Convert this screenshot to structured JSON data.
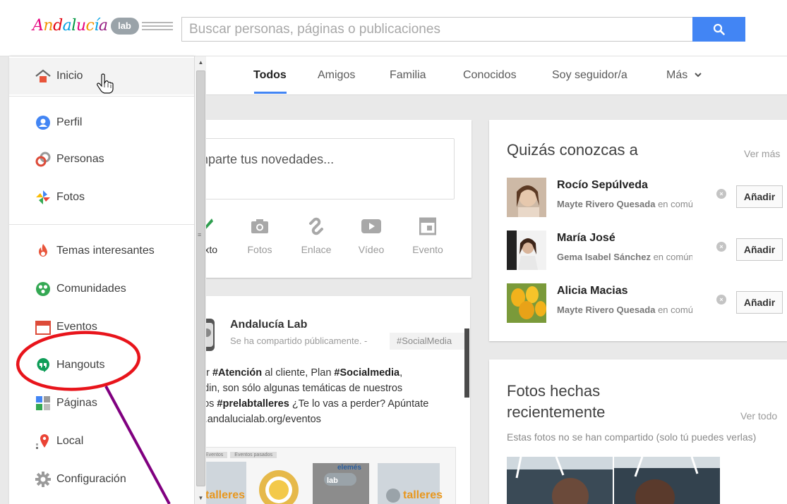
{
  "brand": {
    "logo_text": "Andalucía",
    "logo_badge": "lab"
  },
  "search": {
    "placeholder": "Buscar personas, páginas o publicaciones",
    "icon": "search-icon"
  },
  "sidebar": {
    "items": [
      {
        "key": "inicio",
        "label": "Inicio",
        "icon": "home-icon"
      },
      {
        "key": "perfil",
        "label": "Perfil",
        "icon": "profile-icon"
      },
      {
        "key": "personas",
        "label": "Personas",
        "icon": "people-icon"
      },
      {
        "key": "fotos",
        "label": "Fotos",
        "icon": "photos-icon"
      },
      {
        "key": "temas",
        "label": "Temas interesantes",
        "icon": "flame-icon"
      },
      {
        "key": "comunidades",
        "label": "Comunidades",
        "icon": "communities-icon"
      },
      {
        "key": "eventos",
        "label": "Eventos",
        "icon": "calendar-icon"
      },
      {
        "key": "hangouts",
        "label": "Hangouts",
        "icon": "hangouts-icon"
      },
      {
        "key": "paginas",
        "label": "Páginas",
        "icon": "pages-icon"
      },
      {
        "key": "local",
        "label": "Local",
        "icon": "location-pin-icon"
      },
      {
        "key": "configuracion",
        "label": "Configuración",
        "icon": "gear-icon"
      }
    ]
  },
  "tabs": {
    "items": [
      "Todos",
      "Amigos",
      "Familia",
      "Conocidos",
      "Soy seguidor/a",
      "Más"
    ],
    "active": "Todos"
  },
  "share": {
    "prompt": "mparte tus novedades...",
    "actions": [
      {
        "label": "xto",
        "icon": "pencil-icon"
      },
      {
        "label": "Fotos",
        "icon": "camera-icon"
      },
      {
        "label": "Enlace",
        "icon": "link-icon"
      },
      {
        "label": "Vídeo",
        "icon": "video-icon"
      },
      {
        "label": "Evento",
        "icon": "event-icon"
      }
    ]
  },
  "post": {
    "author": "Andalucía Lab",
    "meta": "Se ha compartido públicamente. -",
    "tag": "#SocialMedia",
    "body": {
      "line1_a": "ter ",
      "line1_b": "#Atención",
      "line1_c": " al cliente, Plan ",
      "line1_d": "#Socialmedia",
      "line1_e": ",",
      "line2": "edin, son sólo algunas temáticas de nuestros",
      "line3_a": "nos ",
      "line3_b": "#prelabtalleres",
      "line3_c": " ¿Te lo vas a perder? Apúntate",
      "line4": "w.andalucialab.org/eventos"
    },
    "image_tabs": [
      "Eventos",
      "Eventos pasados"
    ],
    "image_texts": [
      "talleres",
      "lab",
      "elemés",
      "talleres"
    ]
  },
  "suggestions": {
    "title": "Quizás conozcas a",
    "more": "Ver más",
    "people": [
      {
        "name": "Rocío Sepúlveda",
        "mutual_name": "Mayte Rivero Quesada",
        "mutual_suffix": " en común",
        "button": "Añadir"
      },
      {
        "name": "María José",
        "mutual_name": "Gema Isabel Sánchez",
        "mutual_suffix": " en común",
        "button": "Añadir"
      },
      {
        "name": "Alicia Macias",
        "mutual_name": "Mayte Rivero Quesada",
        "mutual_suffix": " en común",
        "button": "Añadir"
      }
    ]
  },
  "photos": {
    "title": "Fotos hechas recientemente",
    "more": "Ver todo",
    "note": "Estas fotos no se han compartido (solo tú puedes verlas)"
  },
  "colors": {
    "accent": "#4285f4",
    "annotation_circle": "#e8141b",
    "annotation_arrow": "#800080"
  }
}
